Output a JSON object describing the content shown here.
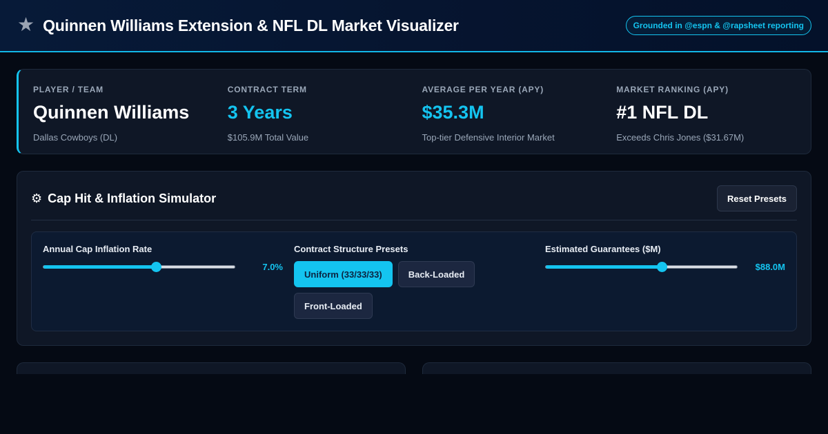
{
  "header": {
    "title": "Quinnen Williams Extension & NFL DL Market Visualizer",
    "badge": "Grounded in @espn & @rapsheet reporting",
    "icon": "star-icon"
  },
  "summary": {
    "stats": [
      {
        "label": "PLAYER / TEAM",
        "value": "Quinnen Williams",
        "sub": "Dallas Cowboys (DL)"
      },
      {
        "label": "CONTRACT TERM",
        "value": "3 Years",
        "sub": "$105.9M Total Value"
      },
      {
        "label": "AVERAGE PER YEAR (APY)",
        "value": "$35.3M",
        "sub": "Top-tier Defensive Interior Market"
      },
      {
        "label": "MARKET RANKING (APY)",
        "value": "#1 NFL DL",
        "sub": "Exceeds Chris Jones ($31.67M)"
      }
    ]
  },
  "simulator": {
    "title": "Cap Hit & Inflation Simulator",
    "icon": "gear-icon",
    "reset_label": "Reset Presets",
    "inflation": {
      "label": "Annual Cap Inflation Rate",
      "value_text": "7.0%",
      "fraction": 0.59
    },
    "presets": {
      "label": "Contract Structure Presets",
      "options": [
        "Uniform (33/33/33)",
        "Back-Loaded",
        "Front-Loaded"
      ],
      "selected": "Uniform (33/33/33)"
    },
    "guarantees": {
      "label": "Estimated Guarantees ($M)",
      "value_text": "$88.0M",
      "fraction": 0.605
    }
  },
  "colors": {
    "accent": "#14c4f0",
    "background": "#050a14",
    "panel": "#0f1726"
  }
}
